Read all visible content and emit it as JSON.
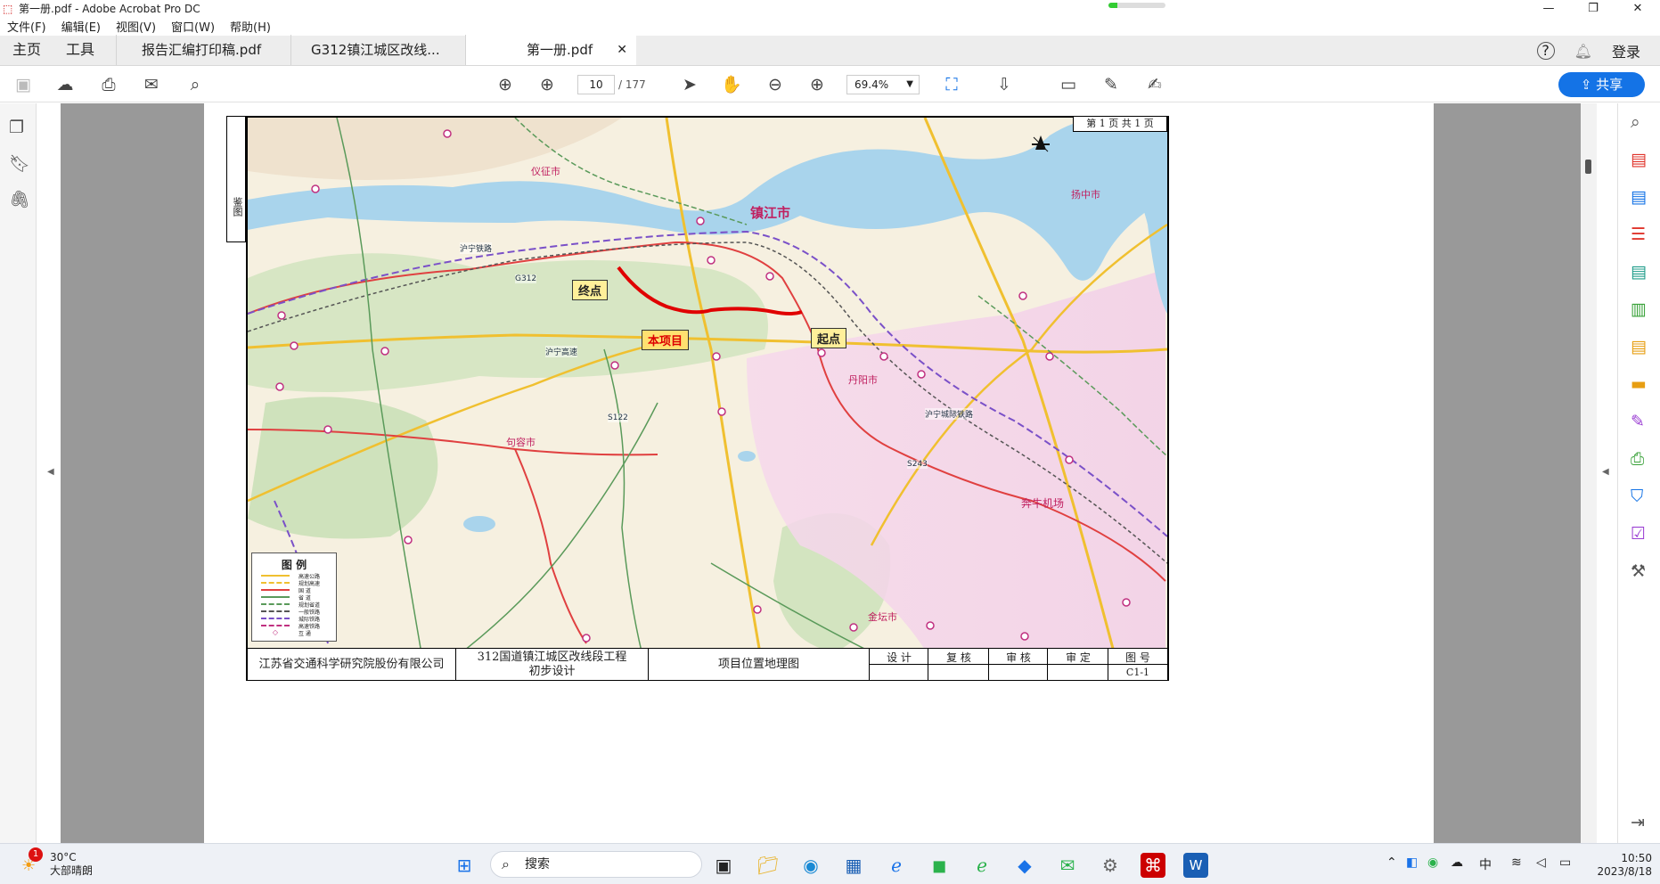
{
  "window": {
    "title": "第一册.pdf - Adobe Acrobat Pro DC"
  },
  "menu": [
    "文件(F)",
    "编辑(E)",
    "视图(V)",
    "窗口(W)",
    "帮助(H)"
  ],
  "tabs": {
    "home": "主页",
    "tools": "工具",
    "docs": [
      {
        "label": "报告汇编打印稿.pdf"
      },
      {
        "label": "G312镇江城区改线..."
      },
      {
        "label": "第一册.pdf"
      }
    ],
    "login": "登录"
  },
  "toolbar": {
    "page_current": "10",
    "page_total": "/ 177",
    "zoom": "69.4%",
    "share": "共享"
  },
  "drawing": {
    "page_info": "第 1 页  共 1 页",
    "side_tab": "鉴图",
    "title_company": "江苏省交通科学研究院股份有限公司",
    "title_project_line1": "312国道镇江城区改线段工程",
    "title_project_line2": "初步设计",
    "title_drawing": "项目位置地理图",
    "title_design": "设 计",
    "title_review": "复 核",
    "title_check": "审 核",
    "title_approve": "审 定",
    "title_no_label": "图 号",
    "title_no": "C1-1",
    "labels": {
      "end": "终点",
      "project": "本项目",
      "start": "起点"
    },
    "cities": {
      "zhenjiang": "镇江市",
      "danyang": "丹阳市",
      "jurong": "句容市",
      "yizheng": "仪征市",
      "yangzhong": "扬中市",
      "airport": "奔牛机场",
      "jintan": "金坛市"
    },
    "roads": [
      "沪宁高速",
      "G312",
      "S122",
      "沪宁铁路",
      "沪宁城际铁路",
      "S243"
    ],
    "legend_title": "图 例",
    "legend": [
      "高速公路",
      "规划高速",
      "国 道",
      "省 道",
      "规划省道",
      "一般铁路",
      "城际铁路",
      "高速铁路",
      "互 通"
    ]
  },
  "taskbar": {
    "temp": "30°C",
    "weather": "大部晴朗",
    "badge": "1",
    "search": "搜索",
    "ime": "中",
    "time": "10:50",
    "date": "2023/8/18"
  }
}
